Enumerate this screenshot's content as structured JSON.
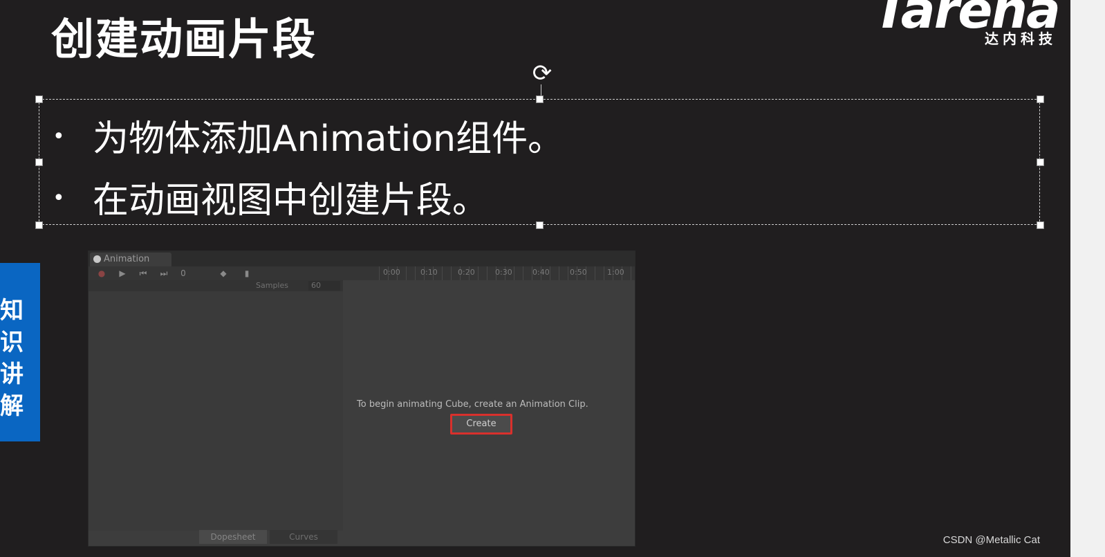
{
  "slide": {
    "title": "创建动画片段",
    "bullets": [
      "为物体添加Animation组件。",
      "在动画视图中创建片段。"
    ],
    "side_tab": [
      "知",
      "识",
      "讲",
      "解"
    ]
  },
  "logo": {
    "word": "Tarena",
    "subtitle": "达内科技"
  },
  "animation_window": {
    "tab_label": "Animation",
    "samples_label": "Samples",
    "samples_value": "60",
    "ruler_labels": [
      "0:00",
      "0:10",
      "0:20",
      "0:30",
      "0:40",
      "0:50",
      "1:00"
    ],
    "message": "To begin animating Cube, create an Animation Clip.",
    "create_button": "Create",
    "bottom_tabs": [
      "Dopesheet",
      "Curves"
    ]
  },
  "watermark": "CSDN @Metallic Cat",
  "colors": {
    "background": "#201e1f",
    "side_tab": "#0a66c2",
    "highlight": "#d9302c"
  }
}
